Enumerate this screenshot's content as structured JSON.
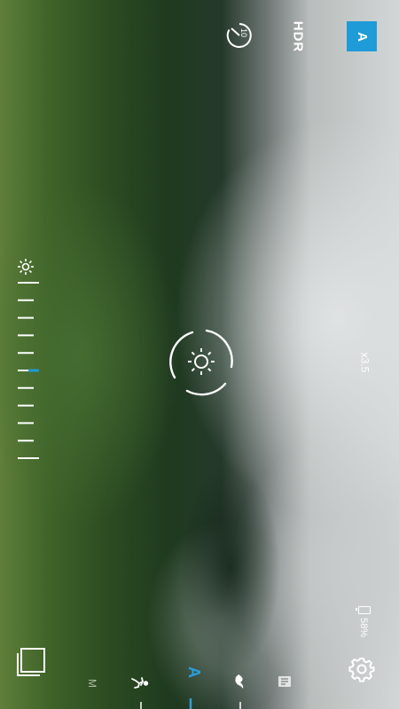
{
  "top_bar": {
    "timer_value": "10",
    "hdr_label": "HDR",
    "auto_label": "A"
  },
  "zoom": {
    "label": "x3.5"
  },
  "battery": {
    "percent_label": "58%"
  },
  "exposure": {
    "level": 0.5,
    "tick_count": 11
  },
  "modes": [
    {
      "id": "manual",
      "label": "M",
      "icon": "manual-mode"
    },
    {
      "id": "sport",
      "label": "",
      "icon": "running-person-icon"
    },
    {
      "id": "auto",
      "label": "A",
      "icon": "auto-mode",
      "selected": true
    },
    {
      "id": "bird",
      "label": "",
      "icon": "bird-icon"
    },
    {
      "id": "document",
      "label": "",
      "icon": "document-icon"
    }
  ],
  "colors": {
    "accent": "#1f9bd7",
    "auto_mode_text": "#2a9fe0",
    "ui_white": "#ffffff"
  },
  "icons": [
    "timer-icon",
    "settings-gear-icon",
    "gallery-icon",
    "sun-icon",
    "focus-ring-icon"
  ]
}
